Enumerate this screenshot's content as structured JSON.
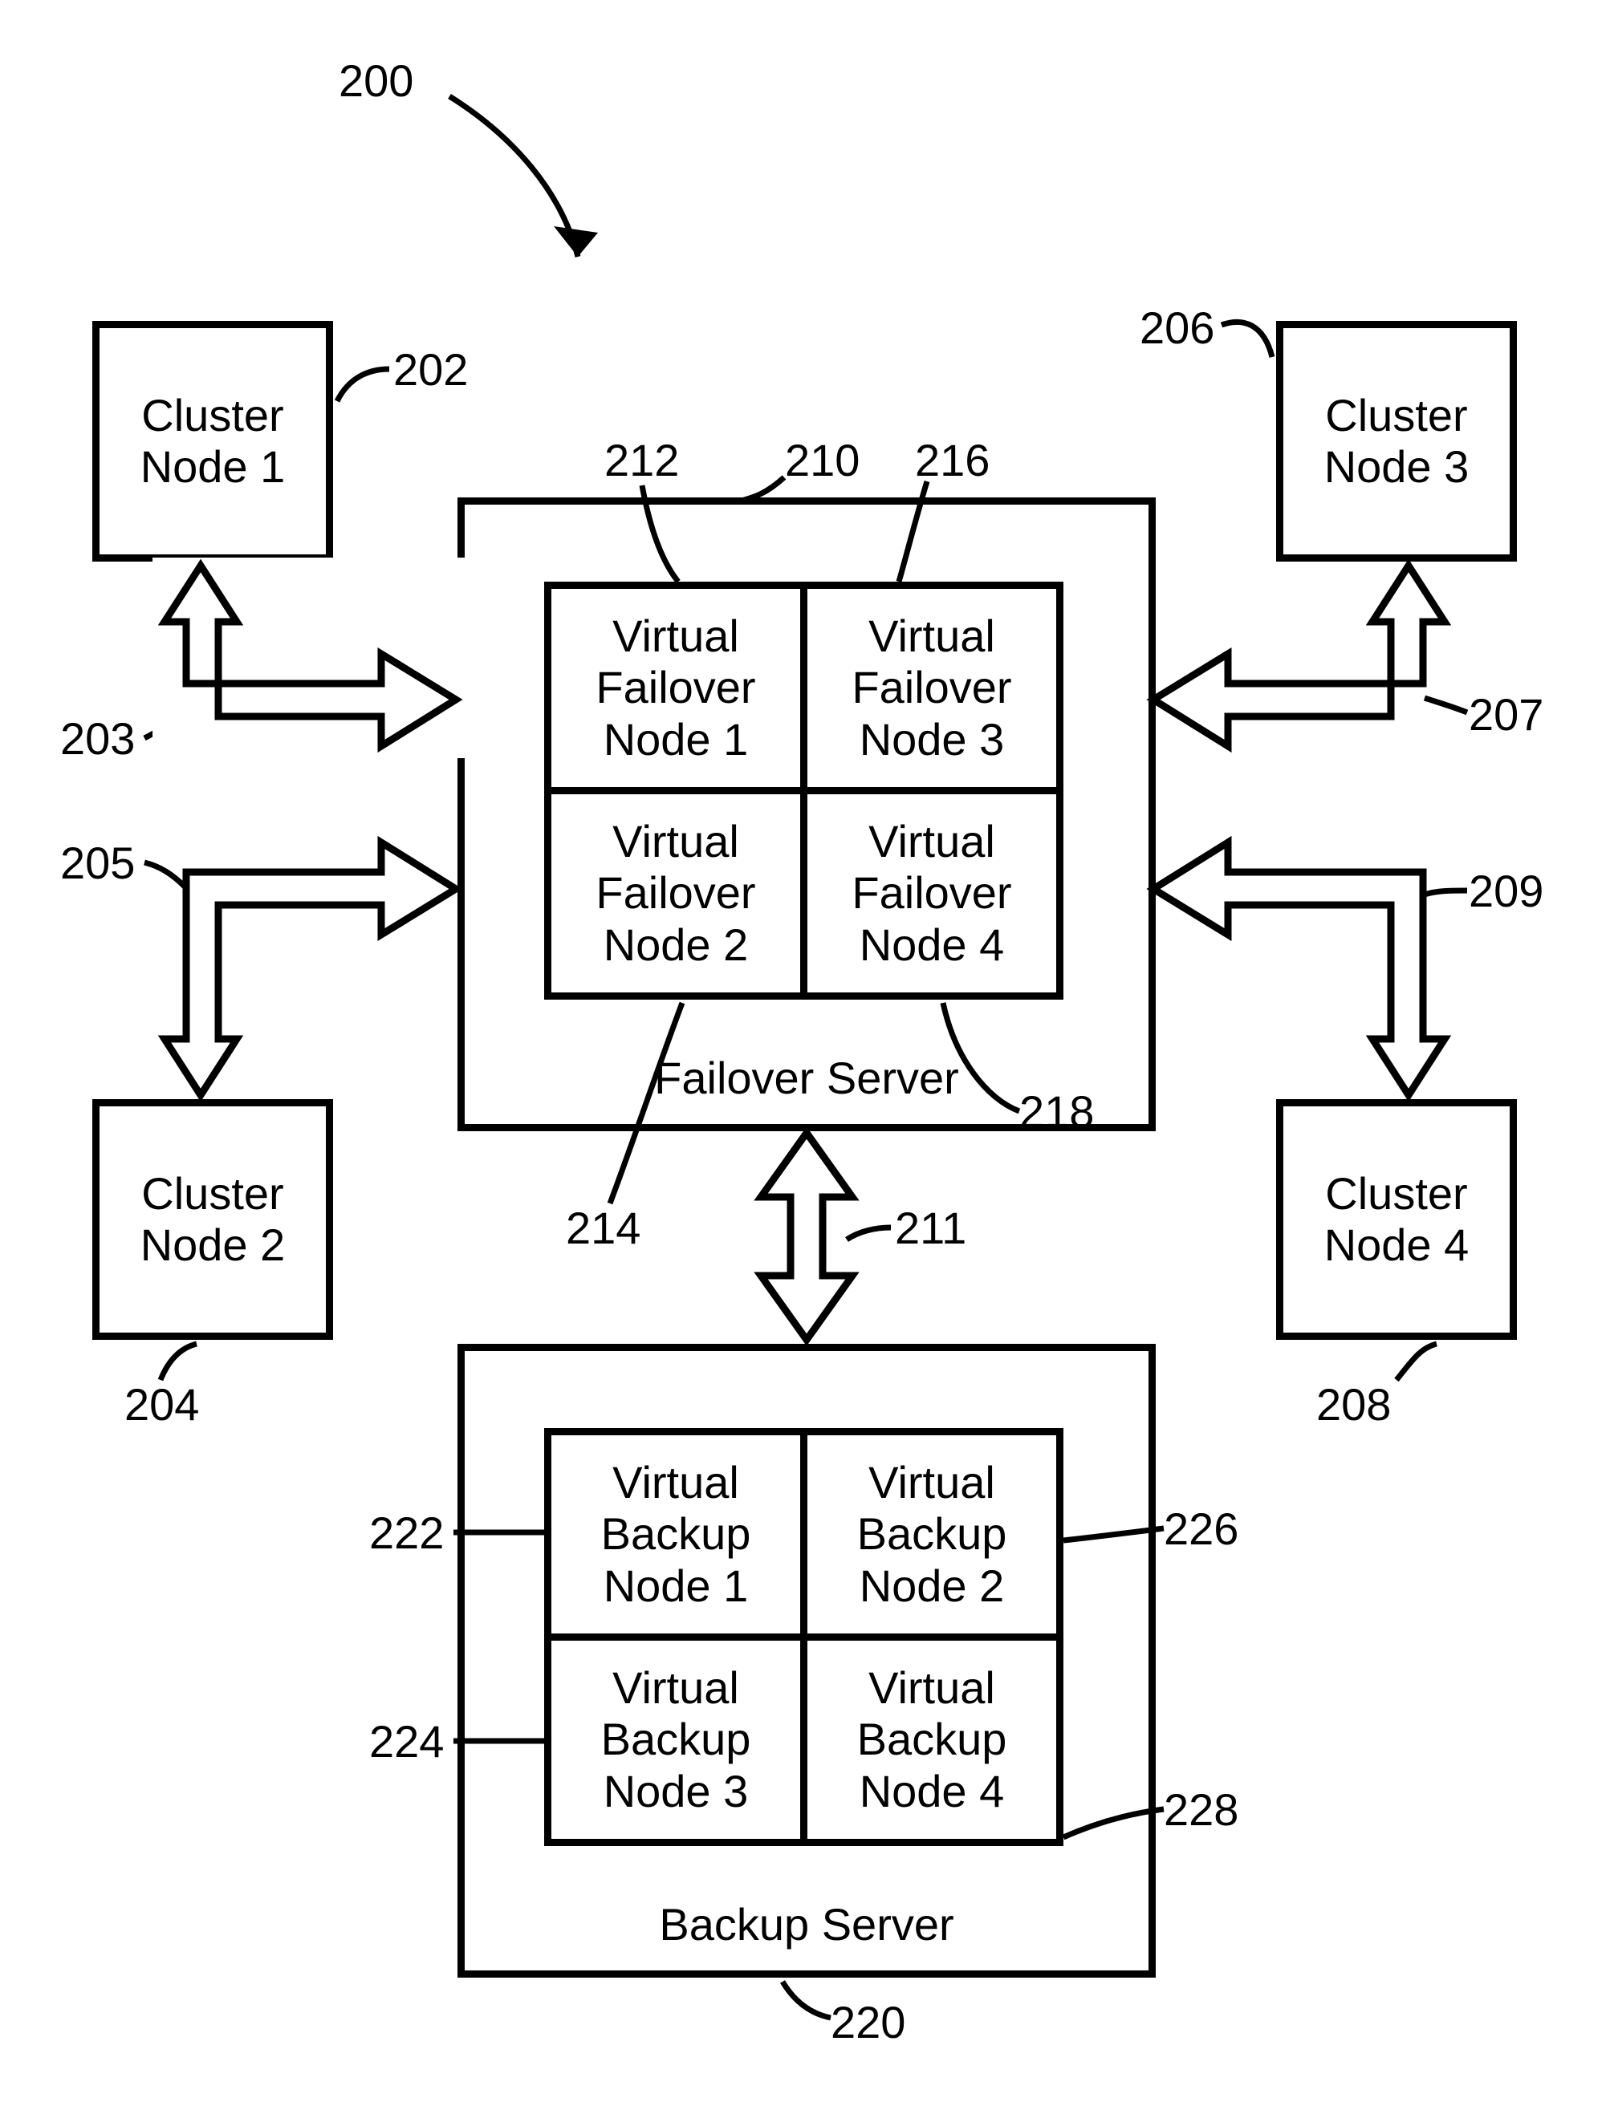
{
  "figure_ref": "200",
  "cluster": {
    "n1": {
      "text": "Cluster\nNode 1",
      "ref": "202",
      "arrow_ref": "203"
    },
    "n2": {
      "text": "Cluster\nNode 2",
      "ref": "204",
      "arrow_ref": "205"
    },
    "n3": {
      "text": "Cluster\nNode 3",
      "ref": "206",
      "arrow_ref": "207"
    },
    "n4": {
      "text": "Cluster\nNode 4",
      "ref": "208",
      "arrow_ref": "209"
    }
  },
  "failover": {
    "caption": "Failover Server",
    "ref": "210",
    "link_ref": "211",
    "vn1": {
      "text": "Virtual\nFailover\nNode 1",
      "ref": "212"
    },
    "vn2": {
      "text": "Virtual\nFailover\nNode 2",
      "ref": "214"
    },
    "vn3": {
      "text": "Virtual\nFailover\nNode 3",
      "ref": "216"
    },
    "vn4": {
      "text": "Virtual\nFailover\nNode 4",
      "ref": "218"
    }
  },
  "backup": {
    "caption": "Backup Server",
    "ref": "220",
    "vn1": {
      "text": "Virtual\nBackup\nNode 1",
      "ref": "222"
    },
    "vn2": {
      "text": "Virtual\nBackup\nNode 2",
      "ref": "226"
    },
    "vn3": {
      "text": "Virtual\nBackup\nNode 3",
      "ref": "224"
    },
    "vn4": {
      "text": "Virtual\nBackup\nNode 4",
      "ref": "228"
    }
  }
}
